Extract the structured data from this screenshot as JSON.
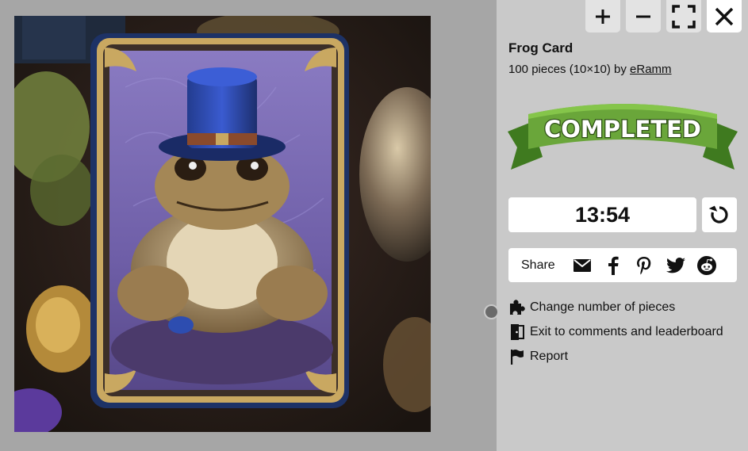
{
  "toolbar": {
    "zoom_in_icon": "plus-icon",
    "zoom_out_icon": "minus-icon",
    "fullscreen_icon": "fullscreen-icon",
    "close_icon": "close-icon"
  },
  "puzzle": {
    "title": "Frog Card",
    "pieces_text": "100 pieces (10×10) by",
    "author": "eRamm"
  },
  "banner": {
    "text": "COMPLETED"
  },
  "timer": {
    "value": "13:54",
    "restart_icon": "restart-icon"
  },
  "share": {
    "label": "Share",
    "icons": [
      "email-icon",
      "facebook-icon",
      "pinterest-icon",
      "twitter-icon",
      "reddit-icon"
    ]
  },
  "menu": {
    "change_pieces": "Change number of pieces",
    "exit": "Exit to comments and leaderboard",
    "report": "Report"
  },
  "colors": {
    "panel_bg": "#c9c9c9",
    "canvas_bg": "#a6a6a6",
    "banner_green": "#5e9b2e"
  }
}
